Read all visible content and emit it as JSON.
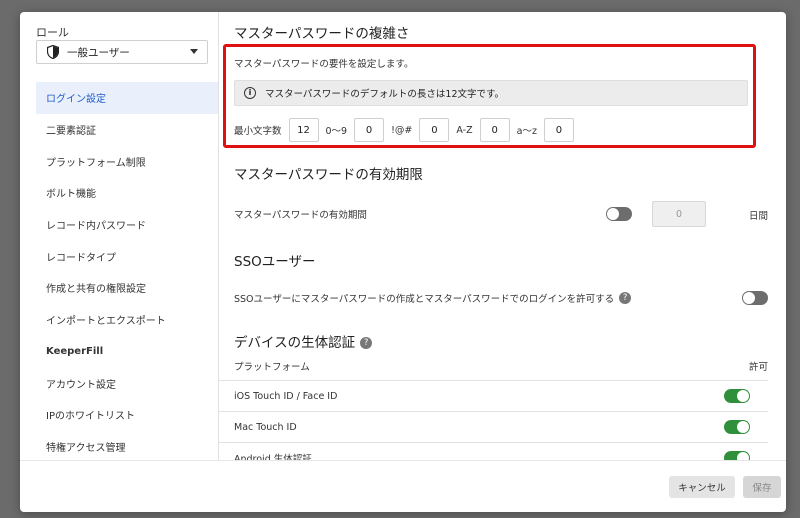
{
  "sidebar": {
    "role_label": "ロール",
    "role_value": "一般ユーザー",
    "items": [
      {
        "label": "ログイン設定",
        "active": true
      },
      {
        "label": "二要素認証"
      },
      {
        "label": "プラットフォーム制限"
      },
      {
        "label": "ボルト機能"
      },
      {
        "label": "レコード内パスワード"
      },
      {
        "label": "レコードタイプ"
      },
      {
        "label": "作成と共有の権限設定"
      },
      {
        "label": "インポートとエクスポート"
      },
      {
        "label": "KeeperFill"
      },
      {
        "label": "アカウント設定"
      },
      {
        "label": "IPのホワイトリスト"
      },
      {
        "label": "特権アクセス管理"
      }
    ]
  },
  "complexity": {
    "title": "マスターパスワードの複雑さ",
    "description": "マスターパスワードの要件を設定します。",
    "info": "マスターパスワードのデフォルトの長さは12文字です。",
    "min_length_label": "最小文字数",
    "min_length": "12",
    "digits_label": "0〜9",
    "digits": "0",
    "symbols_label": "!@#",
    "symbols": "0",
    "upper_label": "A-Z",
    "upper": "0",
    "lower_label": "a〜z",
    "lower": "0"
  },
  "expiration": {
    "title": "マスターパスワードの有効期限",
    "label": "マスターパスワードの有効期間",
    "enabled": false,
    "days_placeholder": "0",
    "unit": "日間"
  },
  "sso": {
    "title": "SSOユーザー",
    "label": "SSOユーザーにマスターパスワードの作成とマスターパスワードでのログインを許可する",
    "enabled": false
  },
  "biometrics": {
    "title": "デバイスの生体認証",
    "col_platform": "プラットフォーム",
    "col_allow": "許可",
    "rows": [
      {
        "label": "iOS Touch ID / Face ID",
        "enabled": true
      },
      {
        "label": "Mac Touch ID",
        "enabled": true
      },
      {
        "label": "Android 生体認証",
        "enabled": true
      }
    ]
  },
  "footer": {
    "cancel": "キャンセル",
    "save": "保存"
  },
  "colors": {
    "accent": "#1f5bd1",
    "highlight_border": "#e01010",
    "toggle_on": "#2f8f3a",
    "toggle_off": "#6d6d6d"
  }
}
